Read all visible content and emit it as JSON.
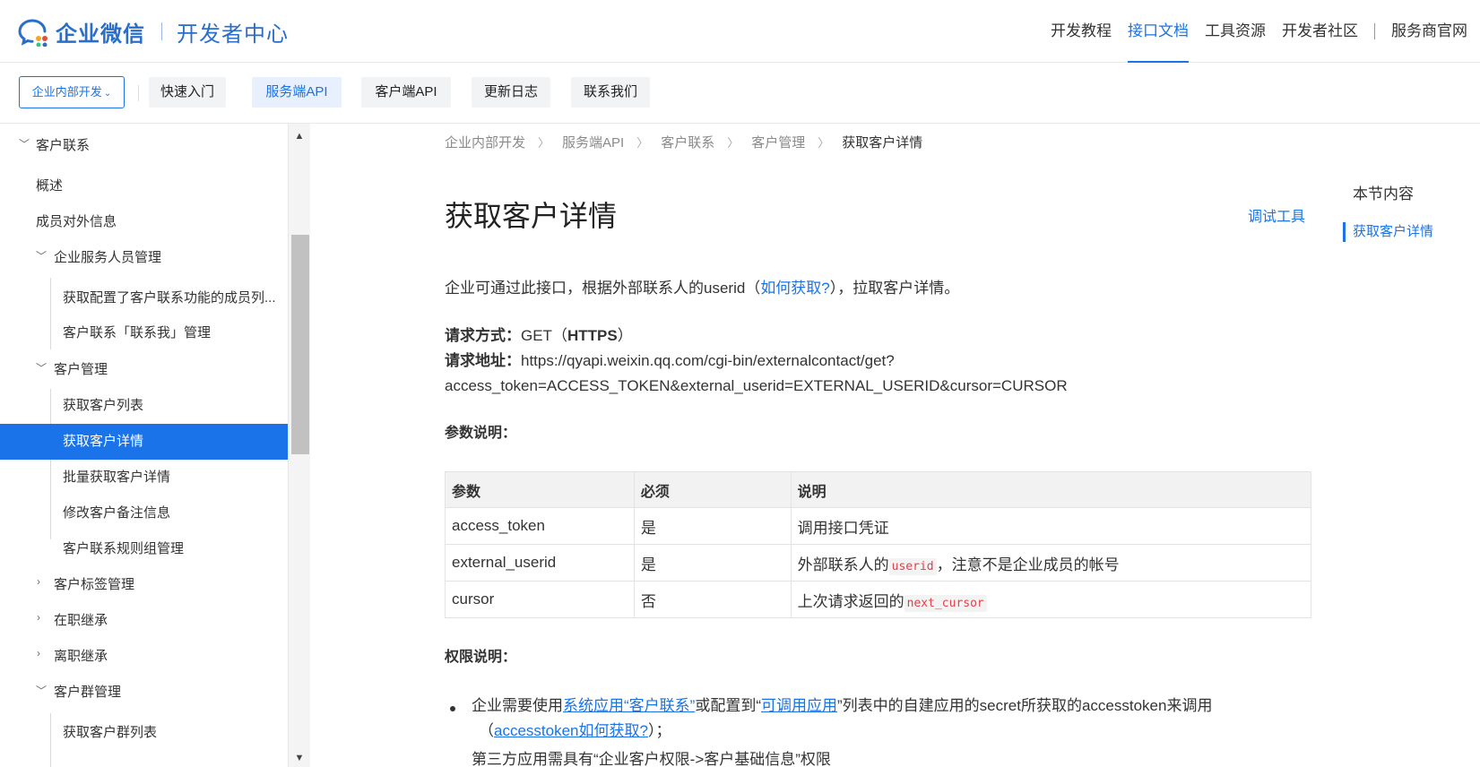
{
  "header": {
    "logo_text": "企业微信",
    "logo_sub": "开发者中心",
    "nav": [
      {
        "label": "开发教程",
        "active": false
      },
      {
        "label": "接口文档",
        "active": true
      },
      {
        "label": "工具资源",
        "active": false
      },
      {
        "label": "开发者社区",
        "active": false
      },
      {
        "label": "服务商官网",
        "active": false
      }
    ]
  },
  "subbar": {
    "scope": "企业内部开发",
    "tabs": [
      "快速入门",
      "服务端API",
      "客户端API",
      "更新日志",
      "联系我们"
    ],
    "active_tab": "服务端API"
  },
  "sidebar": {
    "items": [
      {
        "label": "客户联系",
        "expanded": true
      },
      {
        "label": "概述"
      },
      {
        "label": "成员对外信息"
      },
      {
        "label": "企业服务人员管理",
        "expanded": true
      },
      {
        "label": "获取配置了客户联系功能的成员列..."
      },
      {
        "label": "客户联系「联系我」管理"
      },
      {
        "label": "客户管理",
        "expanded": true
      },
      {
        "label": "获取客户列表"
      },
      {
        "label": "获取客户详情",
        "active": true
      },
      {
        "label": "批量获取客户详情"
      },
      {
        "label": "修改客户备注信息"
      },
      {
        "label": "客户联系规则组管理"
      },
      {
        "label": "客户标签管理",
        "expanded": false
      },
      {
        "label": "在职继承",
        "expanded": false
      },
      {
        "label": "离职继承",
        "expanded": false
      },
      {
        "label": "客户群管理",
        "expanded": true
      },
      {
        "label": "获取客户群列表"
      }
    ]
  },
  "breadcrumb": [
    "企业内部开发",
    "服务端API",
    "客户联系",
    "客户管理",
    "获取客户详情"
  ],
  "page": {
    "title": "获取客户详情",
    "debug_tool": "调试工具",
    "intro_before": "企业可通过此接口，根据外部联系人的userid（",
    "intro_link": "如何获取?",
    "intro_after": "），拉取客户详情。",
    "method_label": "请求方式：",
    "method_value": "GET（",
    "method_https": "HTTPS",
    "method_close": "）",
    "url_label": "请求地址：",
    "url_line1": "https://qyapi.weixin.qq.com/cgi-bin/externalcontact/get?",
    "url_line2": "access_token=ACCESS_TOKEN&external_userid=EXTERNAL_USERID&cursor=CURSOR",
    "params_heading": "参数说明：",
    "permissions_heading": "权限说明：",
    "perm1_a": "企业需要使用",
    "perm1_link1": "系统应用“客户联系”",
    "perm1_b": "或配置到“",
    "perm1_link2": "可调用应用",
    "perm1_c": "”列表中的自建应用的secret所获取的accesstoken来调用",
    "perm1_d": "（",
    "perm1_link3": "accesstoken如何获取?",
    "perm1_e": "）；",
    "perm2_partial": "第三方应用需具有“企业客户权限->客户基础信息”权限"
  },
  "params_table": {
    "headers": [
      "参数",
      "必须",
      "说明"
    ],
    "rows": [
      {
        "name": "access_token",
        "required": "是",
        "desc_before": "调用接口凭证",
        "code": "",
        "desc_after": ""
      },
      {
        "name": "external_userid",
        "required": "是",
        "desc_before": "外部联系人的",
        "code": "userid",
        "desc_after": "，注意不是企业成员的帐号"
      },
      {
        "name": "cursor",
        "required": "否",
        "desc_before": "上次请求返回的",
        "code": "next_cursor",
        "desc_after": ""
      }
    ]
  },
  "toc": {
    "title": "本节内容",
    "items": [
      "获取客户详情"
    ]
  },
  "colors": {
    "accent": "#1a73e8",
    "code": "#e0404a"
  }
}
